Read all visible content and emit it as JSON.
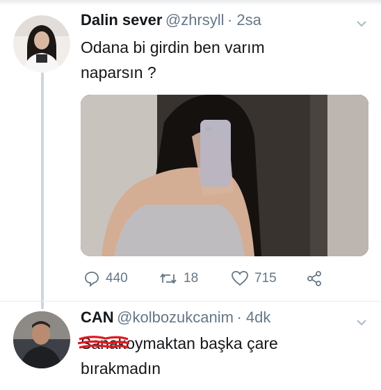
{
  "tweet1": {
    "name": "Dalin sever",
    "handle": "@zhrsyll",
    "time": "· 2sa",
    "text_line1": "Odana bi girdin ben varım",
    "text_line2": "naparsın ?",
    "replies": "440",
    "retweets": "18",
    "likes": "715"
  },
  "tweet2": {
    "name": "CAN",
    "handle": "@kolbozukcanim",
    "time": "· 4dk",
    "censored": "Sana",
    "text_line1_rest": "koymaktan başka çare",
    "text_line2": "bırakmadın"
  },
  "icons": [
    "chevron-down-icon",
    "reply-icon",
    "retweet-icon",
    "like-icon",
    "share-icon"
  ],
  "colors": {
    "muted": "#657786",
    "text": "#14171a",
    "scribble": "#e0191f"
  }
}
